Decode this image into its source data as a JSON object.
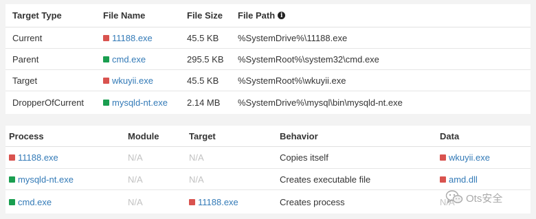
{
  "files_table": {
    "headers": [
      "Target Type",
      "File Name",
      "File Size",
      "File Path"
    ],
    "rows": [
      {
        "target_type": "Current",
        "file_name": "11188.exe",
        "color": "red",
        "file_size": "45.5 KB",
        "file_path": "%SystemDrive%\\11188.exe"
      },
      {
        "target_type": "Parent",
        "file_name": "cmd.exe",
        "color": "green",
        "file_size": "295.5 KB",
        "file_path": "%SystemRoot%\\system32\\cmd.exe"
      },
      {
        "target_type": "Target",
        "file_name": "wkuyii.exe",
        "color": "red",
        "file_size": "45.5 KB",
        "file_path": "%SystemRoot%\\wkuyii.exe"
      },
      {
        "target_type": "DropperOfCurrent",
        "file_name": "mysqld-nt.exe",
        "color": "green",
        "file_size": "2.14 MB",
        "file_path": "%SystemDrive%\\mysql\\bin\\mysqld-nt.exe"
      }
    ]
  },
  "behavior_table": {
    "headers": [
      "Process",
      "Module",
      "Target",
      "Behavior",
      "Data"
    ],
    "rows": [
      {
        "process": "11188.exe",
        "process_color": "red",
        "module": "N/A",
        "target": "N/A",
        "target_color": "",
        "behavior": "Copies itself",
        "data": "wkuyii.exe",
        "data_color": "red"
      },
      {
        "process": "mysqld-nt.exe",
        "process_color": "green",
        "module": "N/A",
        "target": "N/A",
        "target_color": "",
        "behavior": "Creates executable file",
        "data": "amd.dll",
        "data_color": "red"
      },
      {
        "process": "cmd.exe",
        "process_color": "green",
        "module": "N/A",
        "target": "11188.exe",
        "target_color": "red",
        "behavior": "Creates process",
        "data": "N/A",
        "data_color": ""
      }
    ]
  },
  "icons": {
    "info": "info-circle-icon",
    "watermark": "wechat-icon"
  },
  "colors": {
    "red": "#d9534f",
    "green": "#1a9e50",
    "link": "#337ab7",
    "muted": "#c2c2c2"
  },
  "watermark": {
    "text": "Ots安全"
  }
}
